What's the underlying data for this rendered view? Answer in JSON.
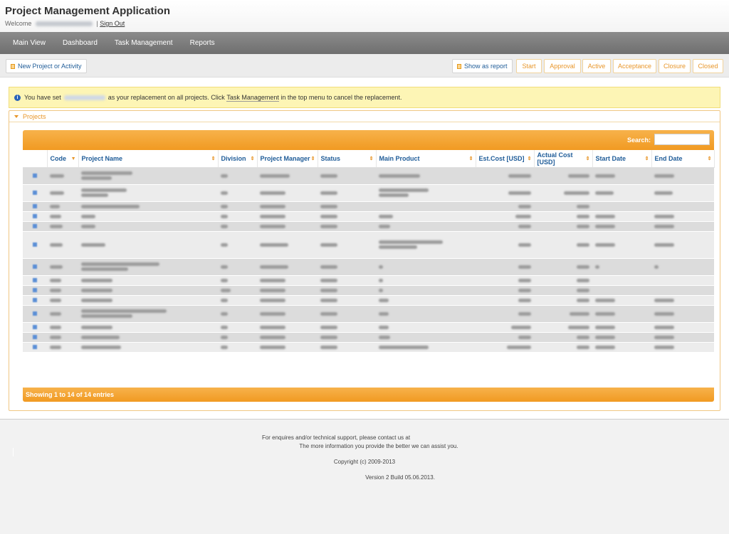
{
  "header": {
    "title": "Project Management Application",
    "welcome_prefix": "Welcome",
    "sign_out": "Sign Out"
  },
  "nav": {
    "items": [
      "Main View",
      "Dashboard",
      "Task Management",
      "Reports"
    ]
  },
  "toolbar": {
    "new_label": "New Project or Activity",
    "report_label": "Show as report",
    "stages": [
      "Start",
      "Approval",
      "Active",
      "Acceptance",
      "Closure",
      "Closed"
    ]
  },
  "info": {
    "prefix": "You have set",
    "middle": "as your replacement on all projects. Click",
    "link": "Task Management",
    "suffix": "in the top menu to cancel the replacement."
  },
  "projects": {
    "panel_title": "Projects",
    "search_label": "Search:",
    "columns": [
      "Code",
      "Project Name",
      "Division",
      "Project Manager",
      "Status",
      "Main Product",
      "Est.Cost [USD]",
      "Actual Cost [USD]",
      "Start Date",
      "End Date"
    ],
    "footer": "Showing 1 to 14 of 14 entries",
    "row_count": 14
  },
  "footer": {
    "line1": "For enquires and/or technical support, please contact us at",
    "line2": "The more information you provide the better we can assist you.",
    "copyright": "Copyright (c) 2009-2013",
    "version": "Version 2 Build 05.06.2013."
  },
  "colors": {
    "accent_orange": "#f19a22",
    "nav_gray": "#7a7a7a",
    "info_yellow": "#fdf5b5",
    "link_blue": "#1f5c98"
  }
}
